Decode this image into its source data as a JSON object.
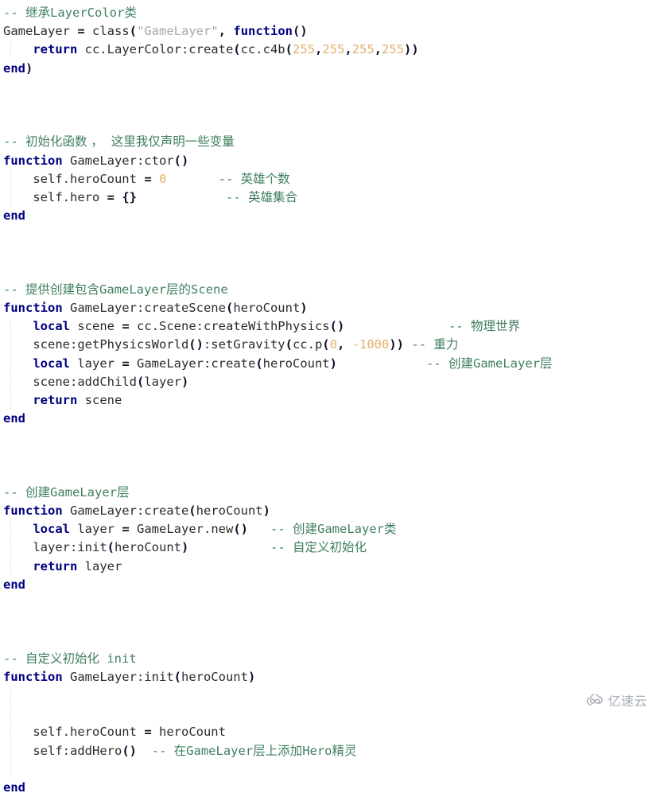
{
  "document": {
    "type": "source-code-listing",
    "language": "Lua",
    "colors": {
      "background": "#ffffff",
      "keyword": "#000080",
      "comment": "#3f7f5f",
      "string": "#a8a8a8",
      "number": "#e2b06a",
      "punctuation": "#0d0d28",
      "plain": "#2b2b2b",
      "indent_guide": "#c9c9c9",
      "watermark": "#9aa0ac"
    }
  },
  "lines": [
    {
      "n": 1,
      "indent": 0,
      "guide": false,
      "tokens": [
        {
          "t": "com",
          "v": "-- "
        },
        {
          "t": "com-cjk",
          "v": "继承"
        },
        {
          "t": "com",
          "v": "LayerColor"
        },
        {
          "t": "com-cjk",
          "v": "类"
        }
      ]
    },
    {
      "n": 2,
      "indent": 0,
      "guide": false,
      "tokens": [
        {
          "t": "plain",
          "v": "GameLayer "
        },
        {
          "t": "op",
          "v": "="
        },
        {
          "t": "plain",
          "v": " class"
        },
        {
          "t": "punc",
          "v": "("
        },
        {
          "t": "str",
          "v": "\"GameLayer\""
        },
        {
          "t": "punc",
          "v": ","
        },
        {
          "t": "plain",
          "v": " "
        },
        {
          "t": "kw",
          "v": "function"
        },
        {
          "t": "punc",
          "v": "()"
        }
      ]
    },
    {
      "n": 3,
      "indent": 1,
      "guide": true,
      "tokens": [
        {
          "t": "kw",
          "v": "return"
        },
        {
          "t": "plain",
          "v": " cc.LayerColor:create"
        },
        {
          "t": "punc",
          "v": "("
        },
        {
          "t": "plain",
          "v": "cc.c4b"
        },
        {
          "t": "punc",
          "v": "("
        },
        {
          "t": "num",
          "v": "255"
        },
        {
          "t": "punc",
          "v": ","
        },
        {
          "t": "num",
          "v": "255"
        },
        {
          "t": "punc",
          "v": ","
        },
        {
          "t": "num",
          "v": "255"
        },
        {
          "t": "punc",
          "v": ","
        },
        {
          "t": "num",
          "v": "255"
        },
        {
          "t": "punc",
          "v": "))"
        }
      ]
    },
    {
      "n": 4,
      "indent": 0,
      "guide": false,
      "tokens": [
        {
          "t": "kw",
          "v": "end"
        },
        {
          "t": "punc",
          "v": ")"
        }
      ]
    },
    {
      "n": 5,
      "indent": 0,
      "guide": false,
      "tokens": []
    },
    {
      "n": 6,
      "indent": 0,
      "guide": false,
      "tokens": []
    },
    {
      "n": 7,
      "indent": 0,
      "guide": false,
      "tokens": []
    },
    {
      "n": 8,
      "indent": 0,
      "guide": false,
      "tokens": [
        {
          "t": "com",
          "v": "-- "
        },
        {
          "t": "com-cjk",
          "v": "初始化函数 ，  这里我仅声明一些变量"
        }
      ]
    },
    {
      "n": 9,
      "indent": 0,
      "guide": false,
      "tokens": [
        {
          "t": "kw",
          "v": "function"
        },
        {
          "t": "plain",
          "v": " GameLayer:ctor"
        },
        {
          "t": "punc",
          "v": "()"
        }
      ]
    },
    {
      "n": 10,
      "indent": 1,
      "guide": true,
      "tokens": [
        {
          "t": "plain",
          "v": "self.heroCount "
        },
        {
          "t": "op",
          "v": "="
        },
        {
          "t": "plain",
          "v": " "
        },
        {
          "t": "num",
          "v": "0"
        },
        {
          "t": "plain",
          "v": "       "
        },
        {
          "t": "com",
          "v": "-- "
        },
        {
          "t": "com-cjk",
          "v": "英雄个数"
        }
      ]
    },
    {
      "n": 11,
      "indent": 1,
      "guide": true,
      "tokens": [
        {
          "t": "plain",
          "v": "self.hero "
        },
        {
          "t": "op",
          "v": "="
        },
        {
          "t": "plain",
          "v": " "
        },
        {
          "t": "punc",
          "v": "{}"
        },
        {
          "t": "plain",
          "v": "            "
        },
        {
          "t": "com",
          "v": "-- "
        },
        {
          "t": "com-cjk",
          "v": "英雄集合"
        }
      ]
    },
    {
      "n": 12,
      "indent": 0,
      "guide": false,
      "tokens": [
        {
          "t": "kw",
          "v": "end"
        }
      ]
    },
    {
      "n": 13,
      "indent": 0,
      "guide": false,
      "tokens": []
    },
    {
      "n": 14,
      "indent": 0,
      "guide": false,
      "tokens": []
    },
    {
      "n": 15,
      "indent": 0,
      "guide": false,
      "tokens": []
    },
    {
      "n": 16,
      "indent": 0,
      "guide": false,
      "tokens": [
        {
          "t": "com",
          "v": "-- "
        },
        {
          "t": "com-cjk",
          "v": "提供创建包含"
        },
        {
          "t": "com",
          "v": "GameLayer"
        },
        {
          "t": "com-cjk",
          "v": "层的"
        },
        {
          "t": "com",
          "v": "Scene"
        }
      ]
    },
    {
      "n": 17,
      "indent": 0,
      "guide": false,
      "tokens": [
        {
          "t": "kw",
          "v": "function"
        },
        {
          "t": "plain",
          "v": " GameLayer:createScene"
        },
        {
          "t": "punc",
          "v": "("
        },
        {
          "t": "plain",
          "v": "heroCount"
        },
        {
          "t": "punc",
          "v": ")"
        }
      ]
    },
    {
      "n": 18,
      "indent": 1,
      "guide": true,
      "tokens": [
        {
          "t": "kw",
          "v": "local"
        },
        {
          "t": "plain",
          "v": " scene "
        },
        {
          "t": "op",
          "v": "="
        },
        {
          "t": "plain",
          "v": " cc.Scene:createWithPhysics"
        },
        {
          "t": "punc",
          "v": "()"
        },
        {
          "t": "plain",
          "v": "              "
        },
        {
          "t": "com",
          "v": "-- "
        },
        {
          "t": "com-cjk",
          "v": "物理世界"
        }
      ]
    },
    {
      "n": 19,
      "indent": 1,
      "guide": true,
      "tokens": [
        {
          "t": "plain",
          "v": "scene:getPhysicsWorld"
        },
        {
          "t": "punc",
          "v": "()"
        },
        {
          "t": "plain",
          "v": ":setGravity"
        },
        {
          "t": "punc",
          "v": "("
        },
        {
          "t": "plain",
          "v": "cc.p"
        },
        {
          "t": "punc",
          "v": "("
        },
        {
          "t": "num",
          "v": "0"
        },
        {
          "t": "punc",
          "v": ","
        },
        {
          "t": "plain",
          "v": " "
        },
        {
          "t": "num",
          "v": "-1000"
        },
        {
          "t": "punc",
          "v": "))"
        },
        {
          "t": "plain",
          "v": " "
        },
        {
          "t": "com",
          "v": "-- "
        },
        {
          "t": "com-cjk",
          "v": "重力"
        }
      ]
    },
    {
      "n": 20,
      "indent": 1,
      "guide": true,
      "tokens": [
        {
          "t": "kw",
          "v": "local"
        },
        {
          "t": "plain",
          "v": " layer "
        },
        {
          "t": "op",
          "v": "="
        },
        {
          "t": "plain",
          "v": " GameLayer:create"
        },
        {
          "t": "punc",
          "v": "("
        },
        {
          "t": "plain",
          "v": "heroCount"
        },
        {
          "t": "punc",
          "v": ")"
        },
        {
          "t": "plain",
          "v": "            "
        },
        {
          "t": "com",
          "v": "-- "
        },
        {
          "t": "com-cjk",
          "v": "创建"
        },
        {
          "t": "com",
          "v": "GameLayer"
        },
        {
          "t": "com-cjk",
          "v": "层"
        }
      ]
    },
    {
      "n": 21,
      "indent": 1,
      "guide": true,
      "tokens": [
        {
          "t": "plain",
          "v": "scene:addChild"
        },
        {
          "t": "punc",
          "v": "("
        },
        {
          "t": "plain",
          "v": "layer"
        },
        {
          "t": "punc",
          "v": ")"
        }
      ]
    },
    {
      "n": 22,
      "indent": 1,
      "guide": true,
      "tokens": [
        {
          "t": "kw",
          "v": "return"
        },
        {
          "t": "plain",
          "v": " scene"
        }
      ]
    },
    {
      "n": 23,
      "indent": 0,
      "guide": false,
      "tokens": [
        {
          "t": "kw",
          "v": "end"
        }
      ]
    },
    {
      "n": 24,
      "indent": 0,
      "guide": false,
      "tokens": []
    },
    {
      "n": 25,
      "indent": 0,
      "guide": false,
      "tokens": []
    },
    {
      "n": 26,
      "indent": 0,
      "guide": false,
      "tokens": []
    },
    {
      "n": 27,
      "indent": 0,
      "guide": false,
      "tokens": [
        {
          "t": "com",
          "v": "-- "
        },
        {
          "t": "com-cjk",
          "v": "创建"
        },
        {
          "t": "com",
          "v": "GameLayer"
        },
        {
          "t": "com-cjk",
          "v": "层"
        }
      ]
    },
    {
      "n": 28,
      "indent": 0,
      "guide": false,
      "tokens": [
        {
          "t": "kw",
          "v": "function"
        },
        {
          "t": "plain",
          "v": " GameLayer:create"
        },
        {
          "t": "punc",
          "v": "("
        },
        {
          "t": "plain",
          "v": "heroCount"
        },
        {
          "t": "punc",
          "v": ")"
        }
      ]
    },
    {
      "n": 29,
      "indent": 1,
      "guide": true,
      "tokens": [
        {
          "t": "kw",
          "v": "local"
        },
        {
          "t": "plain",
          "v": " layer "
        },
        {
          "t": "op",
          "v": "="
        },
        {
          "t": "plain",
          "v": " GameLayer.new"
        },
        {
          "t": "punc",
          "v": "()"
        },
        {
          "t": "plain",
          "v": "   "
        },
        {
          "t": "com",
          "v": "-- "
        },
        {
          "t": "com-cjk",
          "v": "创建"
        },
        {
          "t": "com",
          "v": "GameLayer"
        },
        {
          "t": "com-cjk",
          "v": "类"
        }
      ]
    },
    {
      "n": 30,
      "indent": 1,
      "guide": true,
      "tokens": [
        {
          "t": "plain",
          "v": "layer:init"
        },
        {
          "t": "punc",
          "v": "("
        },
        {
          "t": "plain",
          "v": "heroCount"
        },
        {
          "t": "punc",
          "v": ")"
        },
        {
          "t": "plain",
          "v": "           "
        },
        {
          "t": "com",
          "v": "-- "
        },
        {
          "t": "com-cjk",
          "v": "自定义初始化"
        }
      ]
    },
    {
      "n": 31,
      "indent": 1,
      "guide": true,
      "tokens": [
        {
          "t": "kw",
          "v": "return"
        },
        {
          "t": "plain",
          "v": " layer"
        }
      ]
    },
    {
      "n": 32,
      "indent": 0,
      "guide": false,
      "tokens": [
        {
          "t": "kw",
          "v": "end"
        }
      ]
    },
    {
      "n": 33,
      "indent": 0,
      "guide": false,
      "tokens": []
    },
    {
      "n": 34,
      "indent": 0,
      "guide": false,
      "tokens": []
    },
    {
      "n": 35,
      "indent": 0,
      "guide": false,
      "tokens": []
    },
    {
      "n": 36,
      "indent": 0,
      "guide": false,
      "tokens": [
        {
          "t": "com",
          "v": "-- "
        },
        {
          "t": "com-cjk",
          "v": "自定义初始化"
        },
        {
          "t": "com",
          "v": " init"
        }
      ]
    },
    {
      "n": 37,
      "indent": 0,
      "guide": false,
      "tokens": [
        {
          "t": "kw",
          "v": "function"
        },
        {
          "t": "plain",
          "v": " GameLayer:init"
        },
        {
          "t": "punc",
          "v": "("
        },
        {
          "t": "plain",
          "v": "heroCount"
        },
        {
          "t": "punc",
          "v": ")"
        }
      ]
    },
    {
      "n": 38,
      "indent": 1,
      "guide": true,
      "tokens": []
    },
    {
      "n": 39,
      "indent": 1,
      "guide": true,
      "tokens": []
    },
    {
      "n": 40,
      "indent": 1,
      "guide": true,
      "tokens": [
        {
          "t": "plain",
          "v": "self.heroCount "
        },
        {
          "t": "op",
          "v": "="
        },
        {
          "t": "plain",
          "v": " heroCount"
        }
      ]
    },
    {
      "n": 41,
      "indent": 1,
      "guide": true,
      "tokens": [
        {
          "t": "plain",
          "v": "self:addHero"
        },
        {
          "t": "punc",
          "v": "()"
        },
        {
          "t": "plain",
          "v": "  "
        },
        {
          "t": "com",
          "v": "-- "
        },
        {
          "t": "com-cjk",
          "v": "在"
        },
        {
          "t": "com",
          "v": "GameLayer"
        },
        {
          "t": "com-cjk",
          "v": "层上添加"
        },
        {
          "t": "com",
          "v": "Hero"
        },
        {
          "t": "com-cjk",
          "v": "精灵"
        }
      ]
    },
    {
      "n": 42,
      "indent": 1,
      "guide": true,
      "tokens": []
    },
    {
      "n": 43,
      "indent": 0,
      "guide": false,
      "tokens": [
        {
          "t": "kw",
          "v": "end"
        }
      ]
    }
  ],
  "watermark": {
    "text": "亿速云",
    "icon": "cloud-icon"
  }
}
